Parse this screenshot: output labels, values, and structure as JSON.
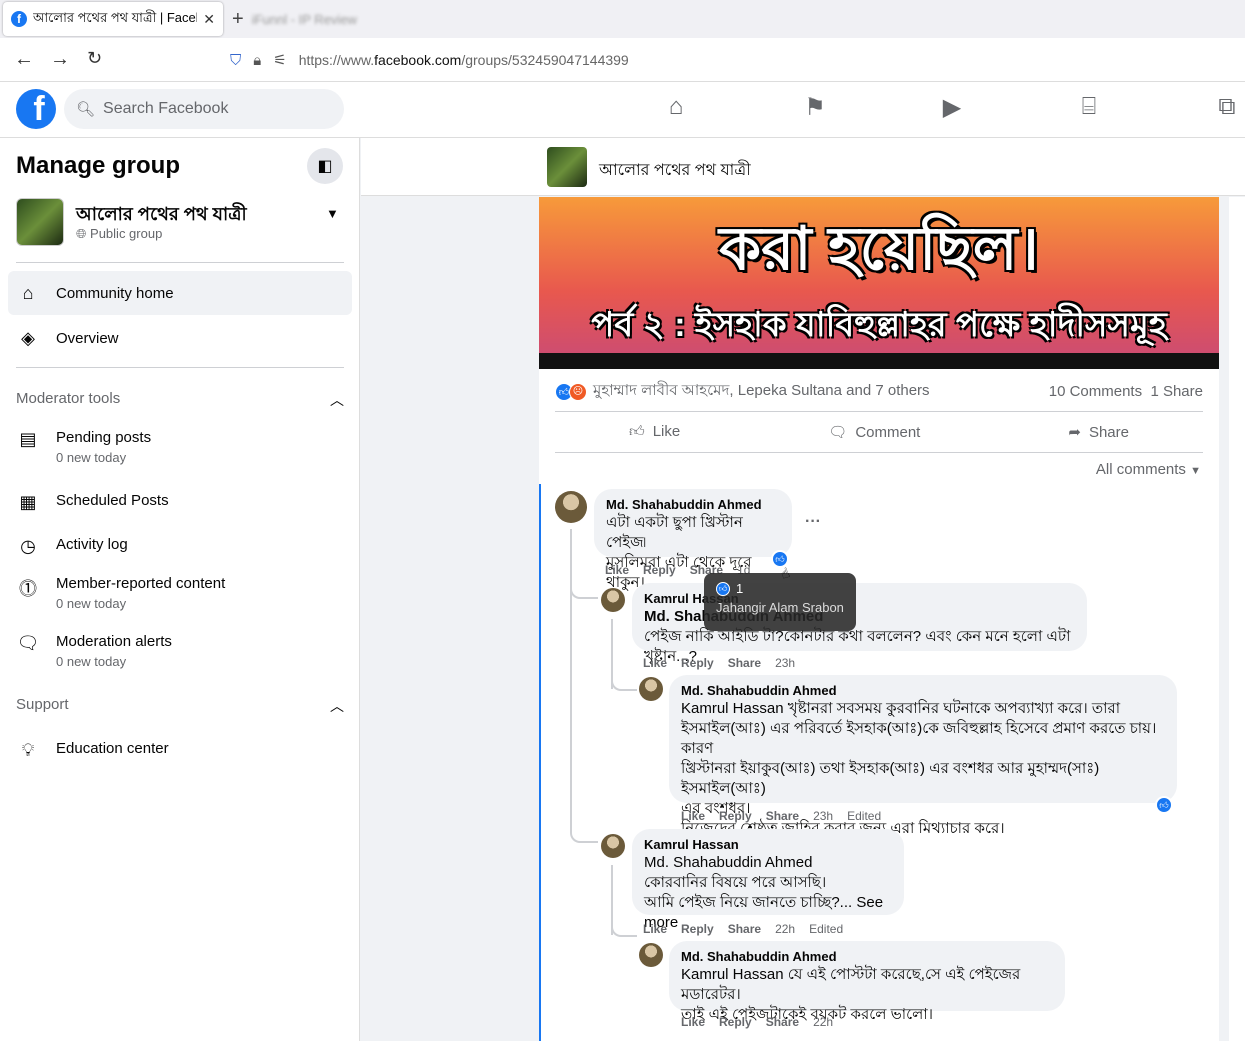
{
  "browser": {
    "active_tab_title": "আলোর পথের পথ যাত্রী | Facebook",
    "inactive_tab_title": "iFunnl - IP Review",
    "url_prefix": "https://www.",
    "url_host": "facebook.com",
    "url_path": "/groups/532459047144399"
  },
  "fb": {
    "logo": "f",
    "search_placeholder": "Search Facebook",
    "nav_icons": [
      "home-icon",
      "flag-icon",
      "video-icon",
      "marketplace-icon",
      "gaming-icon"
    ]
  },
  "sidebar": {
    "title": "Manage group",
    "group_name": "আলোর পথের পথ যাত্রী",
    "group_type": "Public group",
    "items": [
      {
        "label": "Community home",
        "sub": ""
      },
      {
        "label": "Overview",
        "sub": ""
      }
    ],
    "moderator_tools_title": "Moderator tools",
    "mod_items": [
      {
        "label": "Pending posts",
        "sub": "0 new today"
      },
      {
        "label": "Scheduled Posts",
        "sub": ""
      },
      {
        "label": "Activity log",
        "sub": ""
      },
      {
        "label": "Member-reported content",
        "sub": "0 new today"
      },
      {
        "label": "Moderation alerts",
        "sub": "0 new today"
      }
    ],
    "support_title": "Support",
    "support_items": [
      {
        "label": "Education center"
      }
    ]
  },
  "groupbar": {
    "name": "আলোর পথের পথ যাত্রী"
  },
  "post": {
    "banner_line1": "করা হয়েছিল।",
    "banner_line2": "পর্ব ২ : ইসহাক যাবিহুল্লাহর পক্ষে হাদীসসমূহ",
    "reactors": "মুহাম্মাদ লাবীব আহমেদ, Lepeka Sultana and 7 others",
    "comments_count": "10 Comments",
    "shares_count": "1 Share",
    "like": "Like",
    "comment": "Comment",
    "share": "Share",
    "all_comments": "All comments"
  },
  "comments": [
    {
      "author": "Md. Shahabuddin Ahmed",
      "lines": [
        "এটা একটা ছুপা খ্রিস্টান পেইজ৷",
        "মুসলিমরা এটা থেকে দূরে থাকুন।"
      ],
      "like": "Like",
      "reply": "Reply",
      "share": "Share",
      "time": "1d"
    },
    {
      "author": "Kamrul Hassan",
      "tag": "Md. Shahabuddin Ahmed",
      "lines": [
        "পেইজ নাকি আইডি টা?কোনটার কথা বললেন? এবং কেন মনে হলো এটা খৃষ্টান...?"
      ],
      "like": "Like",
      "reply": "Reply",
      "share": "Share",
      "time": "23h"
    },
    {
      "author": "Md. Shahabuddin Ahmed",
      "tag": "Kamrul Hassan",
      "first_line": " খৃষ্টানরা সবসময় কুরবানির ঘটনাকে অপব্যাখ্যা করে। তারা",
      "lines": [
        "ইসমাইল(আঃ) এর পরিবর্তে ইসহাক(আঃ)কে জবিহুল্লাহ হিসেবে প্রমাণ করতে চায়। কারণ",
        "খ্রিস্টানরা ইয়াকুব(আঃ) তথা ইসহাক(আঃ) এর বংশধর আর মুহাম্মদ(সাঃ) ইসমাইল(আঃ)",
        "এর বংশধর।",
        "নিজেদের শ্রেষ্ঠত্ব জাহির করার জন্য এরা মিথ্যাচার করে।"
      ],
      "like": "Like",
      "reply": "Reply",
      "share": "Share",
      "time": "23h",
      "edited": "Edited"
    },
    {
      "author": "Kamrul Hassan",
      "tag": "Md. Shahabuddin Ahmed",
      "lines": [
        "কোরবানির বিষয়ে পরে আসছি।"
      ],
      "last_line": "আমি পেইজ নিয়ে জানতে চাচ্ছি?...",
      "see_more": "See more",
      "like": "Like",
      "reply": "Reply",
      "share": "Share",
      "time": "22h",
      "edited": "Edited"
    },
    {
      "author": "Md. Shahabuddin Ahmed",
      "tag": "Kamrul Hassan",
      "first_line": " যে এই পোস্টটা করেছে,সে এই পেইজের মডারেটর।",
      "lines": [
        "তাই এই পেইজটাকেই বয়কট করলে ভালো।"
      ],
      "like": "Like",
      "reply": "Reply",
      "share": "Share",
      "time": "22h"
    }
  ],
  "tooltip": {
    "count": "1",
    "name": "Jahangir Alam Srabon"
  },
  "colors": {
    "fb_blue": "#1877f2",
    "bg": "#f0f2f5",
    "secondary_text": "#65676b"
  }
}
